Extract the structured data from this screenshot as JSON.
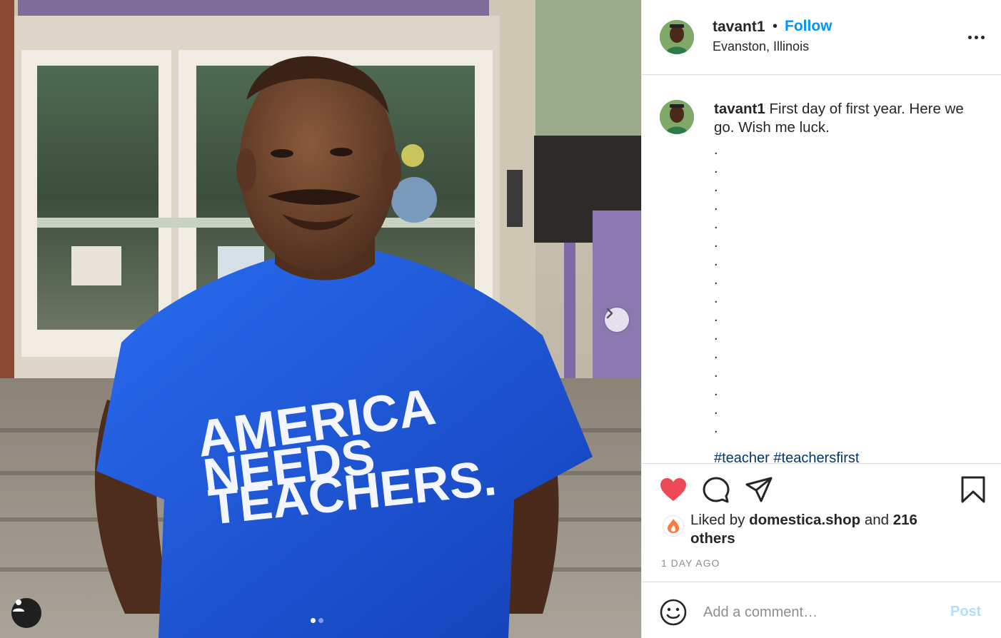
{
  "post": {
    "username": "tavant1",
    "separator": "•",
    "follow_label": "Follow",
    "location": "Evanston, Illinois"
  },
  "photo": {
    "shirt_line_1": "AMERICA",
    "shirt_line_2": "NEEDS",
    "shirt_line_3": "TEACHERS.",
    "carousel_count": 2,
    "carousel_active": 1
  },
  "caption": {
    "username": "tavant1",
    "text": "First day of first year. Here we go. Wish me luck.",
    "dot_lines": [
      ".",
      ".",
      ".",
      ".",
      ".",
      ".",
      ".",
      ".",
      ".",
      ".",
      ".",
      ".",
      ".",
      ".",
      ".",
      "."
    ],
    "hashtags_partial": "#teacher #teachersfirst"
  },
  "likes": {
    "prefix": "Liked by",
    "liked_by_user": "domestica.shop",
    "conjunction": "and",
    "others": "216 others"
  },
  "timestamp": "1 DAY AGO",
  "comment_box": {
    "placeholder": "Add a comment…",
    "post_label": "Post"
  },
  "colors": {
    "accent_blue": "#0095f6",
    "like_red": "#ed4956",
    "post_disabled": "#b2dffc",
    "shirt_blue": "#1a55d6"
  },
  "icons": [
    "chevron-right-icon",
    "user-tag-icon",
    "more-options-icon",
    "heart-icon",
    "comment-icon",
    "share-icon",
    "bookmark-icon",
    "emoji-icon"
  ]
}
